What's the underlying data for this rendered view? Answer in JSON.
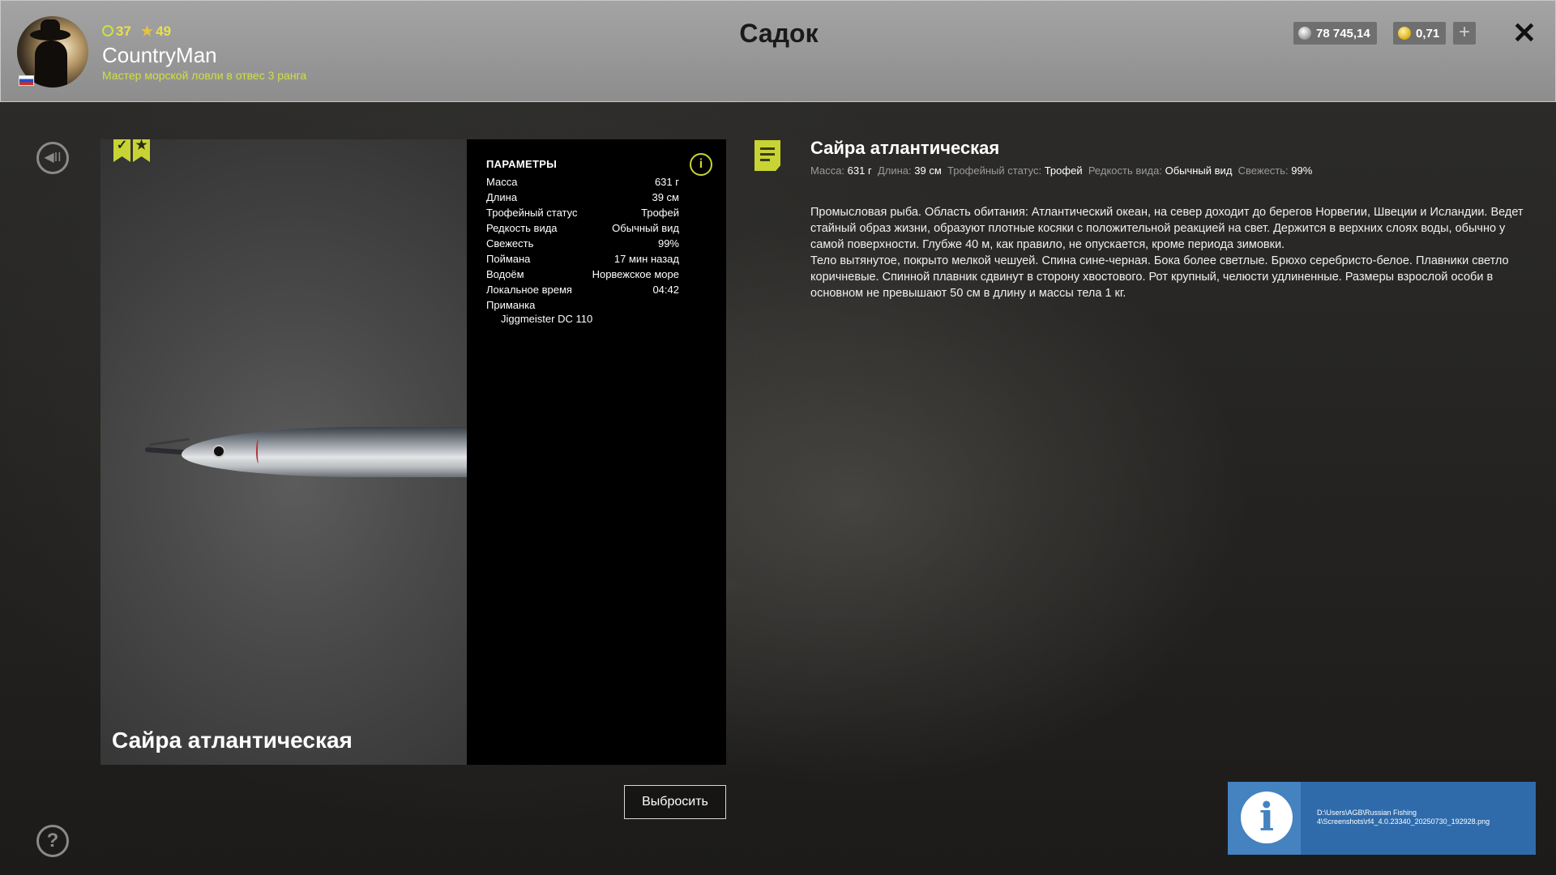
{
  "header": {
    "level": "37",
    "stars": "49",
    "username": "CountryMan",
    "rank": "Мастер морской ловли в отвес 3 ранга",
    "title": "Садок",
    "silver": "78 745,14",
    "gold": "0,71",
    "plus_label": "+",
    "close_label": "✕"
  },
  "fish": {
    "overlay_name": "Сайра атлантическая",
    "badge_check": "✓",
    "badge_star": "★"
  },
  "params": {
    "title": "ПАРАМЕТРЫ",
    "info_label": "i",
    "rows": [
      {
        "label": "Масса",
        "value": "631 г"
      },
      {
        "label": "Длина",
        "value": "39 см"
      },
      {
        "label": "Трофейный статус",
        "value": "Трофей"
      },
      {
        "label": "Редкость вида",
        "value": "Обычный вид"
      },
      {
        "label": "Свежесть",
        "value": "99%"
      },
      {
        "label": "Поймана",
        "value": "17 мин назад"
      },
      {
        "label": "Водоём",
        "value": "Норвежское море"
      },
      {
        "label": "Локальное время",
        "value": "04:42"
      },
      {
        "label": "Приманка",
        "value": ""
      }
    ],
    "lure": "Jiggmeister DC 110"
  },
  "discard_label": "Выбросить",
  "description": {
    "title": "Сайра атлантическая",
    "meta": [
      {
        "label": "Масса:",
        "value": "631 г"
      },
      {
        "label": "Длина:",
        "value": "39 см"
      },
      {
        "label": "Трофейный статус:",
        "value": "Трофей"
      },
      {
        "label": "Редкость вида:",
        "value": "Обычный вид"
      },
      {
        "label": "Свежесть:",
        "value": "99%"
      }
    ],
    "paragraph1": "Промысловая рыба. Область обитания: Атлантический океан, на север доходит до берегов Норвегии, Швеции и Исландии. Ведет стайный образ жизни, образуют плотные косяки с положительной реакцией на свет. Держится в верхних слоях воды, обычно у самой поверхности. Глубже 40 м, как правило, не опускается, кроме периода зимовки.",
    "paragraph2": "Тело вытянутое, покрыто мелкой чешуей. Спина сине-черная. Бока более светлые. Брюхо серебристо-белое. Плавники светло коричневые. Спинной плавник сдвинут в сторону хвостового. Рот крупный, челюсти удлиненные. Размеры взрослой особи в основном не превышают 50 см в длину и массы тела 1 кг."
  },
  "toast": {
    "icon_label": "i",
    "line1": "D:\\Users\\AGB\\Russian Fishing",
    "line2": "4\\Screenshots\\rf4_4.0.23340_20250730_192928.png"
  },
  "side": {
    "back_label": "◀II",
    "help_label": "?"
  },
  "colors": {
    "accent": "#c7d434",
    "toast": "#2f6bab"
  }
}
